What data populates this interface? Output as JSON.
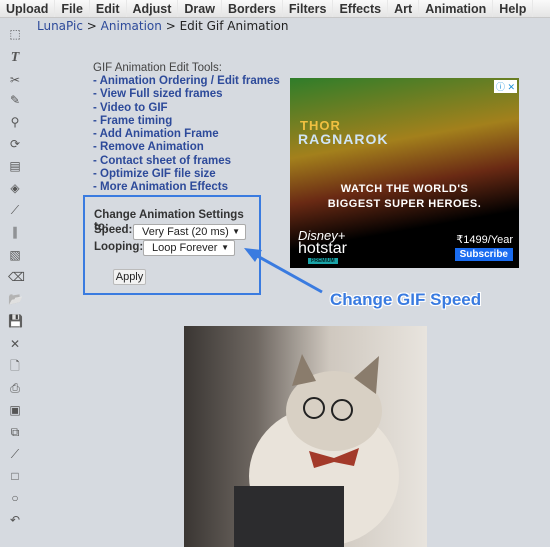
{
  "menu": [
    "Upload",
    "File",
    "Edit",
    "Adjust",
    "Draw",
    "Borders",
    "Filters",
    "Effects",
    "Art",
    "Animation",
    "Help"
  ],
  "breadcrumb": {
    "home": "LunaPic",
    "section": "Animation",
    "sep": ">",
    "current": "Edit Gif Animation"
  },
  "toolbar_icons": [
    "marquee-select-icon",
    "text-icon",
    "scissors-icon",
    "pencil-icon",
    "magnifier-icon",
    "rotate-icon",
    "gradient-icon",
    "paint-bucket-icon",
    "eyedropper-icon",
    "brush-icon",
    "crop-icon",
    "eraser-icon",
    "open-folder-icon",
    "save-icon",
    "close-icon",
    "new-file-icon",
    "print-icon",
    "paste-icon",
    "copy-icon",
    "line-icon",
    "rectangle-icon",
    "ellipse-icon",
    "undo-icon"
  ],
  "tools": {
    "title": "GIF Animation Edit Tools:",
    "links": [
      "- Animation Ordering / Edit frames",
      "- View Full sized frames",
      "- Video to GIF",
      "- Frame timing",
      "- Add Animation Frame",
      "- Remove Animation",
      "- Contact sheet of frames",
      "- Optimize GIF file size",
      "- More Animation Effects"
    ]
  },
  "settings": {
    "heading": "Change Animation Settings to:",
    "speed_label": "Speed:",
    "speed_value": "Very Fast (20 ms)",
    "looping_label": "Looping:",
    "looping_value": "Loop Forever",
    "apply": "Apply"
  },
  "ad": {
    "brand_line1": "THOR",
    "brand_line2": "RAGNAROK",
    "tagline1": "WATCH THE WORLD'S",
    "tagline2": "BIGGEST SUPER HEROES.",
    "disney": "Disney+",
    "hotstar": "hotstar",
    "premium": "PREMIUM",
    "price": "₹1499/Year",
    "subscribe": "Subscribe",
    "controls": "ⓘ ✕"
  },
  "callout": "Change GIF Speed",
  "colors": {
    "accent": "#3a7be0",
    "link": "#2d4a9a",
    "background": "#d6dae0"
  }
}
